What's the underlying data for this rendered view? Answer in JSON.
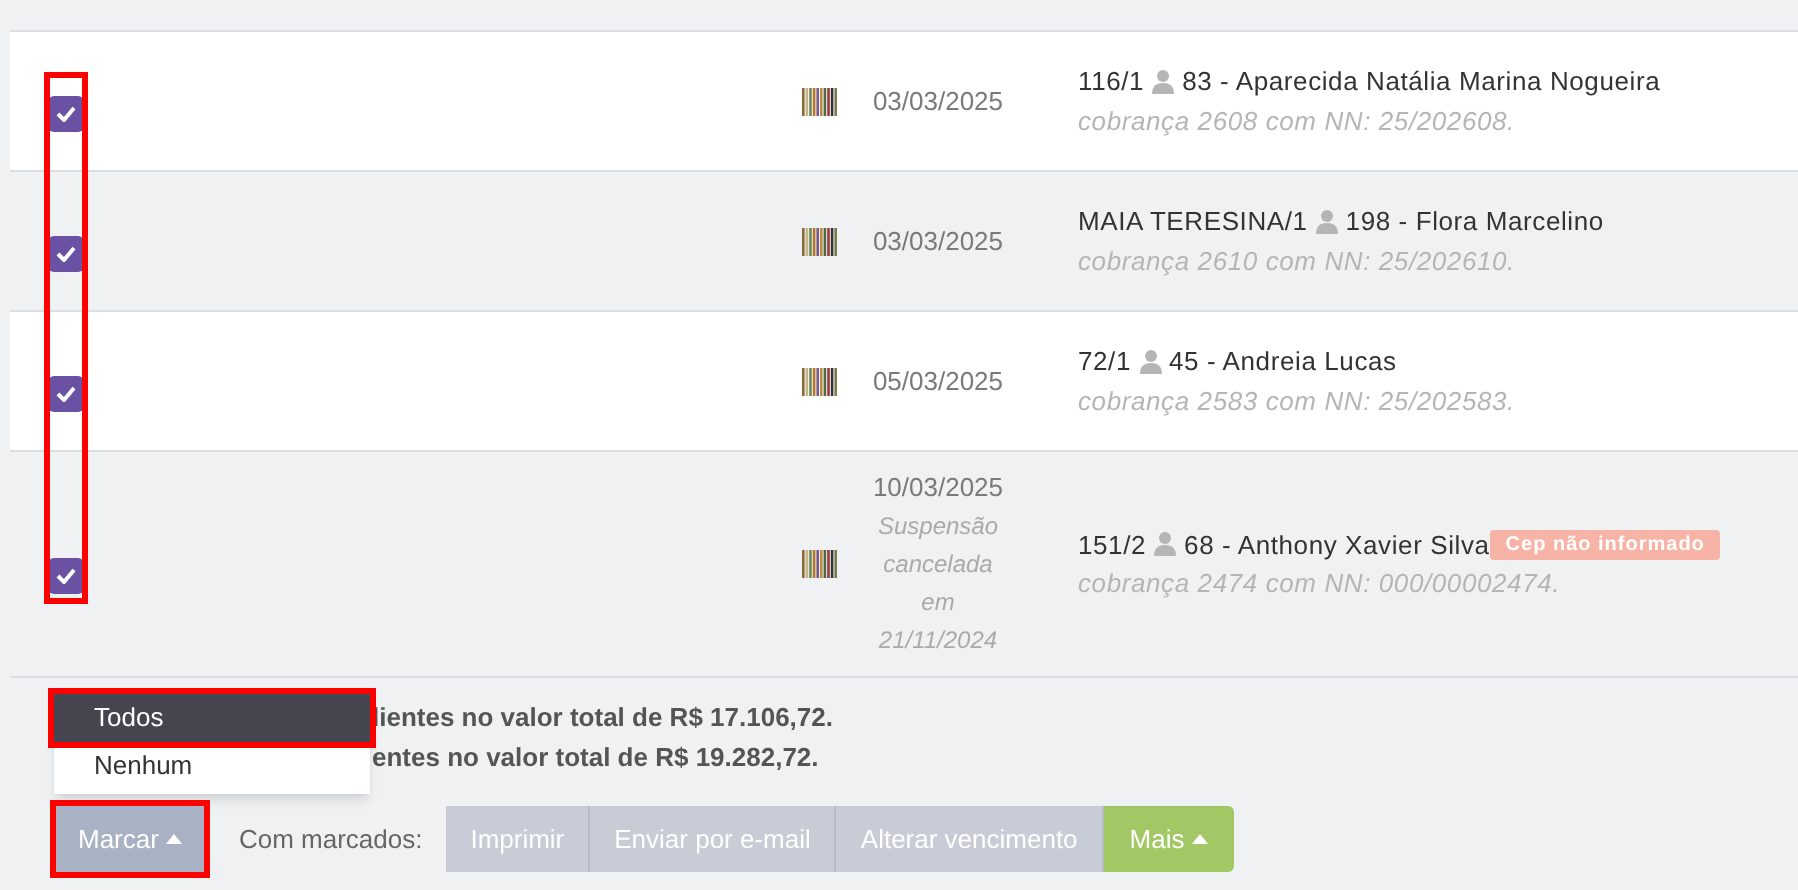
{
  "table": {
    "checkbox_column_highlighted": true,
    "rows": [
      {
        "checked": true,
        "date": "03/03/2025",
        "note": [],
        "unit": "116/1",
        "client_name": "83 - Aparecida Natália Marina Nogueira",
        "charge": "cobrança 2608 com NN: 25/202608.",
        "badge": null
      },
      {
        "checked": true,
        "date": "03/03/2025",
        "note": [],
        "unit": "MAIA TERESINA/1",
        "client_name": "198 - Flora Marcelino",
        "charge": "cobrança 2610 com NN: 25/202610.",
        "badge": null
      },
      {
        "checked": true,
        "date": "05/03/2025",
        "note": [],
        "unit": "72/1",
        "client_name": "45 - Andreia Lucas",
        "charge": "cobrança 2583 com NN: 25/202583.",
        "badge": null
      },
      {
        "checked": true,
        "date": "10/03/2025",
        "note": [
          "Suspensão",
          "cancelada",
          "em",
          "21/11/2024"
        ],
        "unit": "151/2",
        "client_name": "68 - Anthony Xavier Silva",
        "charge": "cobrança 2474 com NN: 000/00002474.",
        "badge": "Cep não informado"
      }
    ]
  },
  "summary": [
    "lientes no valor total de R$ 17.106,72.",
    "entes no valor total de R$ 19.282,72."
  ],
  "mark_menu": {
    "open": true,
    "items": [
      {
        "label": "Todos",
        "selected": true,
        "highlighted": true
      },
      {
        "label": "Nenhum",
        "selected": false,
        "highlighted": false
      }
    ]
  },
  "toolbar": {
    "mark_button": {
      "label": "Marcar",
      "highlighted": true
    },
    "with_marked_label": "Com marcados:",
    "actions": [
      {
        "label": "Imprimir",
        "kind": "plain"
      },
      {
        "label": "Enviar por e-mail",
        "kind": "plain"
      },
      {
        "label": "Alterar vencimento",
        "kind": "plain"
      },
      {
        "label": "Mais",
        "kind": "dropdown"
      }
    ]
  }
}
